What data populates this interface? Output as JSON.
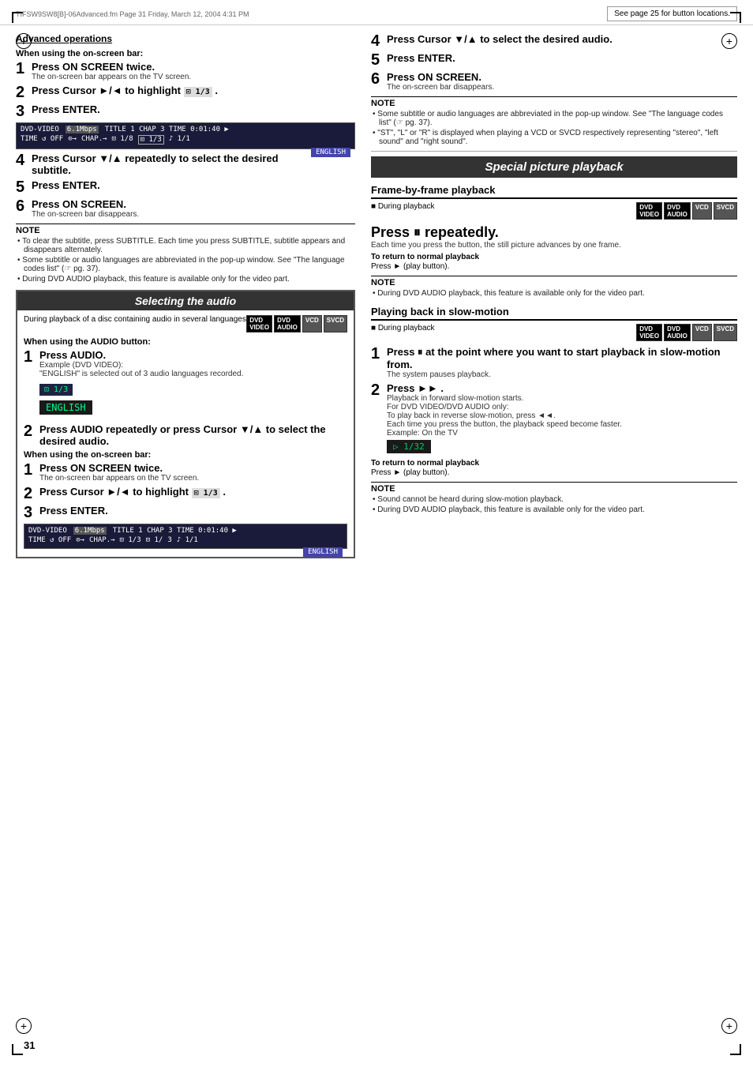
{
  "page": {
    "number": "31",
    "file_info": "TIFSW9SW8[B]-06Advanced.fm  Page 31  Friday, March 12, 2004  4:31 PM",
    "see_page": "See page 25 for button locations.",
    "advanced_ops": "Advanced operations"
  },
  "left_column": {
    "when_onscreen_1": "When using the on-screen bar:",
    "step1_press_on_screen": "Press ON SCREEN twice.",
    "step1_desc": "The on-screen bar appears on the TV screen.",
    "step2_press_cursor": "Press Cursor ►/◄ to highlight",
    "step2_highlight": "⊡ 1/3",
    "step2_period": ".",
    "step3_press_enter": "Press ENTER.",
    "step4_cursor_repeatedly": "Press Cursor ▼/▲ repeatedly to select the desired subtitle.",
    "step5_press_enter": "Press ENTER.",
    "step6_press_on_screen": "Press ON SCREEN.",
    "step6_desc": "The on-screen bar disappears.",
    "note_title": "NOTE",
    "note1": "To clear the subtitle, press SUBTITLE. Each time you press SUBTITLE, subtitle appears and disappears alternately.",
    "note2": "Some subtitle or audio languages are abbreviated in the pop-up window. See \"The language codes list\" (☞ pg. 37).",
    "note3": "During DVD AUDIO playback, this feature is available only for the video part.",
    "selecting_audio": {
      "title": "Selecting the audio",
      "during_playback_desc": "During playback of a disc containing audio in several languages",
      "when_audio_button": "When using the AUDIO button:",
      "s1_title": "Press AUDIO.",
      "s1_desc1": "Example (DVD VIDEO):",
      "s1_desc2": "\"ENGLISH\" is selected out of 3 audio languages recorded.",
      "display_1_3": "⊡ 1/3",
      "display_english": "ENGLISH",
      "s2_title": "Press AUDIO repeatedly or press Cursor ▼/▲ to select the desired audio.",
      "when_onscreen_2": "When using the on-screen bar:",
      "s1b_title": "Press ON SCREEN twice.",
      "s1b_desc": "The on-screen bar appears on the TV screen.",
      "s2b_press_cursor": "Press Cursor ►/◄ to highlight",
      "s2b_highlight": "⊡ 1/3",
      "s2b_period": ".",
      "s3b_press_enter": "Press ENTER."
    }
  },
  "right_column": {
    "step4_title": "Press Cursor ▼/▲ to select the desired audio.",
    "step5_title": "Press ENTER.",
    "step6_title": "Press ON SCREEN.",
    "step6_desc": "The on-screen bar disappears.",
    "note_title": "NOTE",
    "note1": "Some subtitle or audio languages are abbreviated in the pop-up window. See \"The language codes list\" (☞ pg. 37).",
    "note2": "\"ST\", \"L\" or \"R\" is displayed when playing a VCD or SVCD respectively representing \"stereo\", \"left sound\" and \"right sound\".",
    "special_picture": {
      "title": "Special picture playback",
      "frame_by_frame": {
        "title": "Frame-by-frame playback",
        "during_label": "■ During playback",
        "press_title": "Press ⏸ repeatedly.",
        "press_desc": "Each time you press the button, the still picture advances by one frame.",
        "to_return_title": "To return to normal playback",
        "to_return_desc": "Press ► (play button).",
        "note_title": "NOTE",
        "note1": "During DVD AUDIO playback, this feature is available only for the video part."
      },
      "slow_motion": {
        "title": "Playing back in slow-motion",
        "during_label": "■ During playback",
        "step1_title": "Press ⏸ at the point where you want to start playback in slow-motion from.",
        "step1_desc": "The system pauses playback.",
        "step2_title": "Press ►► .",
        "step2_desc1": "Playback in forward slow-motion starts.",
        "step2_for_dvd": "For DVD VIDEO/DVD AUDIO only:",
        "step2_reverse": "To play back in reverse slow-motion, press ◄◄.",
        "step2_each_time": "Each time you press the button, the playback speed become faster.",
        "step2_example": "Example: On the TV",
        "display_1_32": "▷ 1/32",
        "to_return_title": "To return to normal playback",
        "to_return_desc": "Press ► (play button).",
        "note_title": "NOTE",
        "note1": "Sound cannot be heard during slow-motion playback.",
        "note2": "During DVD AUDIO playback, this feature is available only for the video part."
      }
    }
  }
}
